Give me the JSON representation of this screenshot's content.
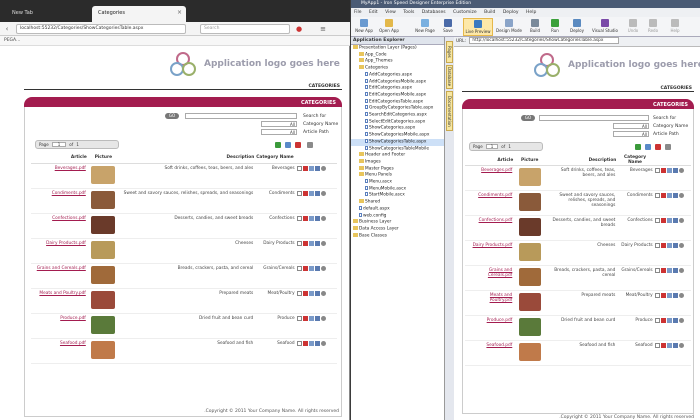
{
  "browser": {
    "tabs": [
      {
        "label": "New Tab"
      },
      {
        "label": "Categories"
      }
    ],
    "url": "localhost:55232/Categories/ShowCategoriesTable.aspx",
    "search_placeholder": "Search",
    "bookmark": "PEGA..."
  },
  "app": {
    "logo_text": "Application logo goes here",
    "tab_label": "CATEGORIES",
    "panel_title": "CATEGORIES",
    "go_label": "GO",
    "search_for": "Search for",
    "filter_name": "Category Name",
    "filter_path": "Article Path",
    "filter_value": "All",
    "pager_label": "Page",
    "page_number": "1",
    "of_label": "of",
    "total_pages": "1",
    "columns": [
      "Article",
      "Picture",
      "Description",
      "Category Name"
    ],
    "rows": [
      {
        "article": "Beverages.pdf",
        "description": "Soft drinks, coffees, teas, beers, and ales",
        "category": "Beverages",
        "color": "#c8a36a"
      },
      {
        "article": "Condiments.pdf",
        "description": "Sweet and savory sauces, relishes, spreads, and seasonings",
        "category": "Condiments",
        "color": "#8a5a3a"
      },
      {
        "article": "Confections.pdf",
        "description": "Desserts, candies, and sweet breads",
        "category": "Confections",
        "color": "#6a3a2a"
      },
      {
        "article": "Dairy Products.pdf",
        "description": "Cheeses",
        "category": "Dairy Products",
        "color": "#b89a5a"
      },
      {
        "article": "Grains and Cereals.pdf",
        "description": "Breads, crackers, pasta, and cereal",
        "category": "Grains/Cereals",
        "color": "#a06a3a"
      },
      {
        "article": "Meats and Poultry.pdf",
        "description": "Prepared meats",
        "category": "Meat/Poultry",
        "color": "#9a4a3a"
      },
      {
        "article": "Produce.pdf",
        "description": "Dried fruit and bean curd",
        "category": "Produce",
        "color": "#5a7a3a"
      },
      {
        "article": "Seafood.pdf",
        "description": "Seafood and fish",
        "category": "Seafood",
        "color": "#c07a4a"
      }
    ],
    "footer": ".Copyright © 2011 Your Company Name. All rights reserved"
  },
  "ide": {
    "title": "MyApp1 - Iron Speed Designer Enterprise Edition",
    "menu": [
      "File",
      "Edit",
      "View",
      "Tools",
      "Databases",
      "Customize",
      "Build",
      "Deploy",
      "Help"
    ],
    "ribbon": [
      "New App",
      "Open App",
      "New Page",
      "Save",
      "Live Preview",
      "Design Mode",
      "Build",
      "Run",
      "Deploy",
      "Visual Studio",
      "Undo",
      "Redo",
      "Help"
    ],
    "explorer_title": "Application Explorer",
    "tree": [
      {
        "label": "Presentation Layer (Pages)",
        "type": "fold",
        "level": 0
      },
      {
        "label": "App_Code",
        "type": "fold",
        "level": 1
      },
      {
        "label": "App_Themes",
        "type": "fold",
        "level": 1
      },
      {
        "label": "Categories",
        "type": "fold",
        "level": 1
      },
      {
        "label": "AddCategories.aspx",
        "type": "file",
        "level": 2
      },
      {
        "label": "AddCategoriesMobile.aspx",
        "type": "file",
        "level": 2
      },
      {
        "label": "EditCategories.aspx",
        "type": "file",
        "level": 2
      },
      {
        "label": "EditCategoriesMobile.aspx",
        "type": "file",
        "level": 2
      },
      {
        "label": "EditCategoriesTable.aspx",
        "type": "file",
        "level": 2
      },
      {
        "label": "GroupByCategoriesTable.aspx",
        "type": "file",
        "level": 2
      },
      {
        "label": "SearchEditCategories.aspx",
        "type": "file",
        "level": 2
      },
      {
        "label": "SelectEditCategories.aspx",
        "type": "file",
        "level": 2
      },
      {
        "label": "ShowCategories.aspx",
        "type": "file",
        "level": 2
      },
      {
        "label": "ShowCategoriesMobile.aspx",
        "type": "file",
        "level": 2
      },
      {
        "label": "ShowCategoriesTable.aspx",
        "type": "file",
        "level": 2,
        "selected": true
      },
      {
        "label": "ShowCategoriesTableMobile",
        "type": "file",
        "level": 2
      },
      {
        "label": "Header and Footer",
        "type": "fold",
        "level": 1
      },
      {
        "label": "Images",
        "type": "fold",
        "level": 1
      },
      {
        "label": "Master Pages",
        "type": "fold",
        "level": 1
      },
      {
        "label": "Menu Panels",
        "type": "fold",
        "level": 1
      },
      {
        "label": "Menu.ascx",
        "type": "file",
        "level": 2
      },
      {
        "label": "MenuMobile.ascx",
        "type": "file",
        "level": 2
      },
      {
        "label": "StartMobile.ascx",
        "type": "file",
        "level": 2
      },
      {
        "label": "Shared",
        "type": "fold",
        "level": 1
      },
      {
        "label": "default.aspx",
        "type": "file",
        "level": 1
      },
      {
        "label": "web.config",
        "type": "file",
        "level": 1
      },
      {
        "label": "Business Layer",
        "type": "fold",
        "level": 0
      },
      {
        "label": "Data Access Layer",
        "type": "fold",
        "level": 0
      },
      {
        "label": "Base Classes",
        "type": "fold",
        "level": 0
      }
    ],
    "side_tabs": [
      "Pages",
      "Database",
      "Documentation"
    ],
    "preview_url_label": "URL:",
    "preview_url": "http://localhost:55232/Categories/ShowCategoriesTable.aspx"
  }
}
